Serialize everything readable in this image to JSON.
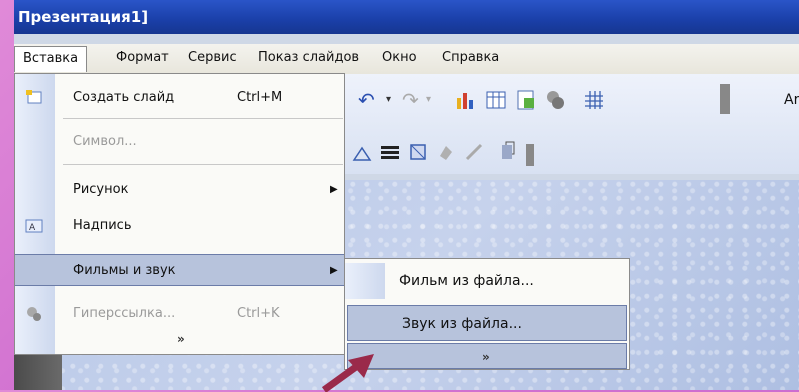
{
  "window": {
    "title": "Презентация1]"
  },
  "menubar": {
    "items": [
      {
        "label": "Вставка",
        "active": true
      },
      {
        "label": "Формат"
      },
      {
        "label": "Сервис"
      },
      {
        "label": "Показ слайдов"
      },
      {
        "label": "Окно"
      },
      {
        "label": "Справка"
      }
    ]
  },
  "toolbar": {
    "font_box_fragment": "Ar"
  },
  "insert_menu": {
    "items": [
      {
        "label": "Создать слайд",
        "shortcut": "Ctrl+M",
        "icon": "new-slide-icon",
        "enabled": true
      },
      {
        "label": "Символ...",
        "enabled": false
      },
      {
        "label": "Рисунок",
        "submenu": true,
        "enabled": true
      },
      {
        "label": "Надпись",
        "icon": "text-box-icon",
        "enabled": true
      },
      {
        "label": "Фильмы и звук",
        "submenu": true,
        "highlighted": true,
        "enabled": true
      },
      {
        "label": "Гиперссылка...",
        "shortcut": "Ctrl+K",
        "icon": "hyperlink-icon",
        "enabled": false
      }
    ],
    "expand_glyph": "»"
  },
  "movies_sound_submenu": {
    "items": [
      {
        "label": "Фильм из файла..."
      },
      {
        "label": "Звук из файла...",
        "highlighted": true
      }
    ],
    "expand_glyph": "»"
  },
  "colors": {
    "title_bar": "#1a3fa8",
    "highlight": "#b7c3dc",
    "pointer_arrow": "#9a2a4a",
    "background": "#d070d0"
  }
}
